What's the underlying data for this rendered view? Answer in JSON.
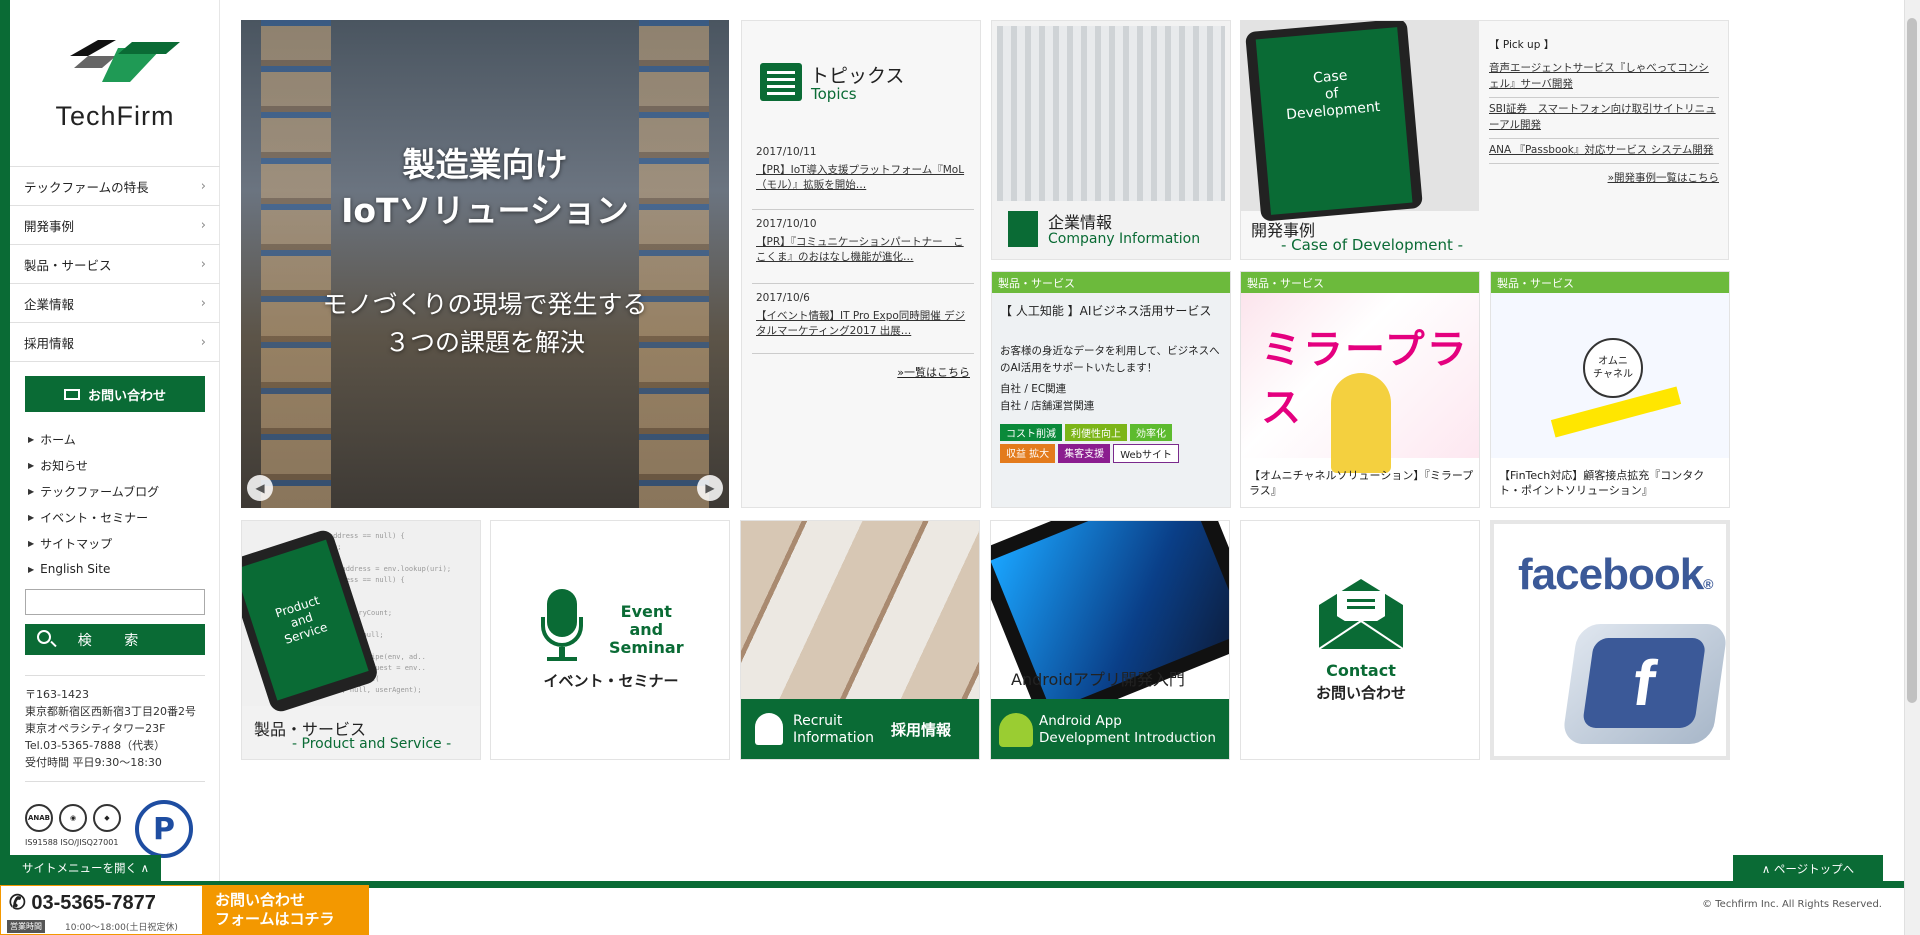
{
  "brand": {
    "name": "TechFirm",
    "color_primary": "#0a6b35",
    "color_accent": "#f39800",
    "color_product": "#6cba3c"
  },
  "sidebar": {
    "nav": [
      {
        "label": "テックファームの特長"
      },
      {
        "label": "開発事例"
      },
      {
        "label": "製品・サービス"
      },
      {
        "label": "企業情報"
      },
      {
        "label": "採用情報"
      }
    ],
    "contact_label": "お問い合わせ",
    "links": [
      {
        "label": "ホーム"
      },
      {
        "label": "お知らせ"
      },
      {
        "label": "テックファームブログ"
      },
      {
        "label": "イベント・セミナー"
      },
      {
        "label": "サイトマップ"
      },
      {
        "label": "English Site"
      }
    ],
    "search": {
      "placeholder": "",
      "button_label": "検 索"
    },
    "address": {
      "postal": "〒163-1423",
      "line1": "東京都新宿区西新宿3丁目20番2号",
      "line2": "東京オペラシティタワー23F",
      "tel": "Tel.03-5365-7888（代表）",
      "hours": "受付時間 平日9:30〜18:30"
    },
    "certs": {
      "iso": "IS91588 ISO/JISQ27001",
      "anab": "ANAB"
    },
    "open_menu_label": "サイトメニューを開く ∧"
  },
  "hero": {
    "title_line1": "製造業向け",
    "title_line2": "IoTソリューション",
    "sub_line1": "モノづくりの現場で発生する",
    "sub_line2": "３つの課題を解決"
  },
  "topics": {
    "title_jp": "トピックス",
    "title_en": "Topics",
    "items": [
      {
        "date": "2017/10/11",
        "text": "【PR】IoT導入支援プラットフォーム『MoL（モル）』拡販を開始…"
      },
      {
        "date": "2017/10/10",
        "text": "【PR】『コミュニケーションパートナー　ここくま』のおはなし機能が進化…"
      },
      {
        "date": "2017/10/6",
        "text": "【イベント情報】IT Pro Expo同時開催 デジタルマーケティング2017 出展…"
      }
    ],
    "more": "»一覧はこちら"
  },
  "company": {
    "title_jp": "企業情報",
    "title_en": "Company Information"
  },
  "case": {
    "screen_text": "Case\nof\nDevelopment",
    "title_jp": "開発事例",
    "title_en": "- Case of Development -",
    "pickup_header": "【 Pick up 】",
    "pickup": [
      {
        "text": "音声エージェントサービス『しゃべってコンシェル』サーバ開発"
      },
      {
        "text": "SBI証券　スマートフォン向け取引サイトリニューアル開発"
      },
      {
        "text": "ANA 『Passbook』対応サービス システム開発"
      }
    ],
    "more": "»開発事例一覧はこちら"
  },
  "products": {
    "header": "製品・サービス",
    "ai": {
      "title": "【 人工知能 】AIビジネス活用サービス",
      "desc": "お客様の身近なデータを利用して、ビジネスへのAI活用をサポートいたします！",
      "meta1": "自社 / EC関連",
      "meta2": "自社 / 店舗運営関連",
      "tags": [
        {
          "label": "コスト削減",
          "color": "#0a8a3a"
        },
        {
          "label": "利便性向上",
          "color": "#7cb518"
        },
        {
          "label": "効率化",
          "color": "#5dbb2e"
        },
        {
          "label": "収益 拡大",
          "color": "#e37b1c"
        },
        {
          "label": "集客支援",
          "color": "#8b1d8f"
        },
        {
          "label": "Webサイト",
          "color": "#ffffff"
        }
      ]
    },
    "mirror": {
      "art_text": "ミラープラス",
      "caption": "【オムニチャネルソリューション】『ミラープラス』"
    },
    "omni": {
      "art_text": "オムニ\nチャネル",
      "caption": "【FinTech対応】顧客接点拡充『コンタクト・ポイントソリューション』"
    }
  },
  "bottom_tiles": {
    "product": {
      "screen_text": "Product\nand\nService",
      "title_jp": "製品・サービス",
      "title_en": "- Product and Service -"
    },
    "event": {
      "title_en": "Event\nand\nSeminar",
      "title_jp": "イベント・セミナー"
    },
    "recruit": {
      "title_en": "Recruit\nInformation",
      "title_jp": "採用情報"
    },
    "android": {
      "title": "Androidアプリ開発入門",
      "title_en": "Android App\nDevelopment Introduction"
    },
    "contact": {
      "title_en": "Contact",
      "title_jp": "お問い合わせ"
    },
    "facebook": {
      "word": "facebook",
      "reg": "®",
      "letter": "f"
    }
  },
  "footer": {
    "phone": "03-5365-7877",
    "hours_tag": "営業時間",
    "hours": "10:00〜18:00(土日祝定休)",
    "form_line1": "お問い合わせ",
    "form_line2": "フォームはコチラ",
    "page_top": "∧ ページトップへ",
    "copyright": "© Techfirm Inc. All Rights Reserved."
  }
}
